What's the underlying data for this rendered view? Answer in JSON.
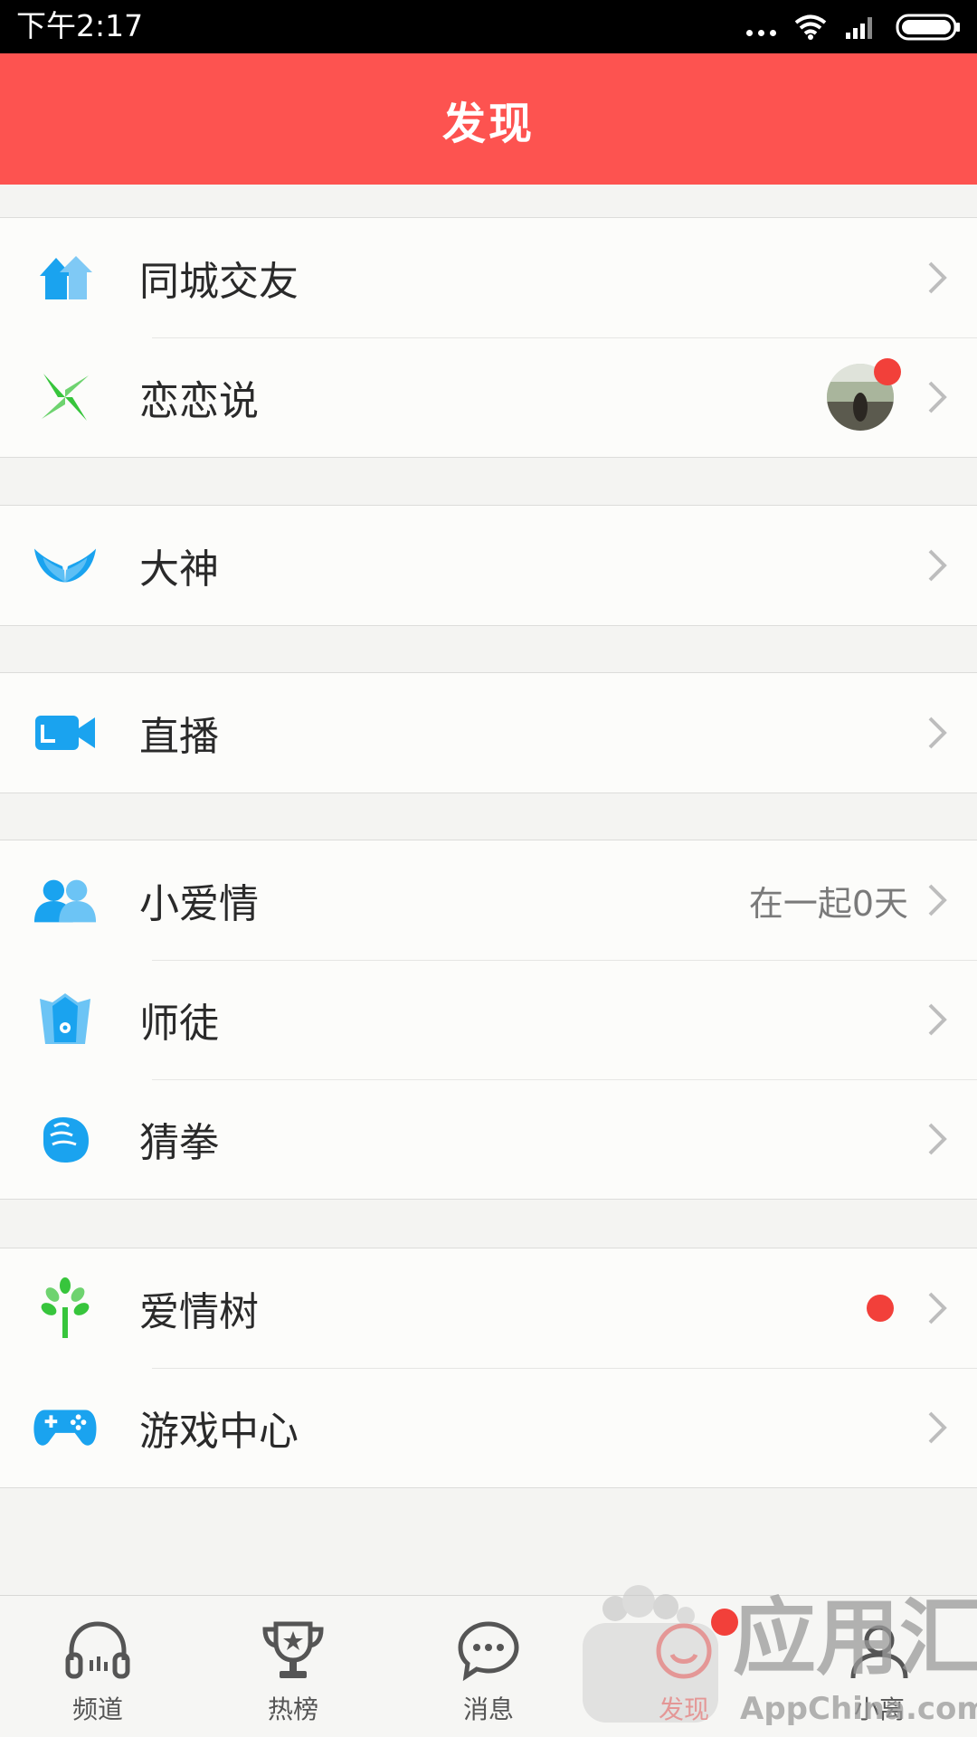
{
  "status_bar": {
    "time": "下午2:17"
  },
  "header": {
    "title": "发现"
  },
  "groups": [
    {
      "items": [
        {
          "label": "同城交友",
          "icon": "house-arrows-icon"
        },
        {
          "label": "恋恋说",
          "icon": "pinwheel-icon",
          "has_avatar_badge": true
        }
      ]
    },
    {
      "items": [
        {
          "label": "大神",
          "icon": "wings-icon"
        }
      ]
    },
    {
      "items": [
        {
          "label": "直播",
          "icon": "video-camera-icon"
        }
      ]
    },
    {
      "items": [
        {
          "label": "小爱情",
          "icon": "couple-icon",
          "extra": "在一起0天"
        },
        {
          "label": "师徒",
          "icon": "pen-nib-icon"
        },
        {
          "label": "猜拳",
          "icon": "fist-icon"
        }
      ]
    },
    {
      "items": [
        {
          "label": "爱情树",
          "icon": "tree-icon",
          "has_red_dot": true
        },
        {
          "label": "游戏中心",
          "icon": "gamepad-icon"
        }
      ]
    }
  ],
  "tabbar": [
    {
      "label": "频道",
      "icon": "headphones-icon"
    },
    {
      "label": "热榜",
      "icon": "trophy-icon"
    },
    {
      "label": "消息",
      "icon": "chat-bubble-icon"
    },
    {
      "label": "发现",
      "icon": "discover-icon",
      "active": true,
      "badge": true
    },
    {
      "label": "小离",
      "icon": "profile-icon"
    }
  ],
  "watermark": {
    "text_cn": "应用汇",
    "text_en": "AppChina.com"
  },
  "colors": {
    "accent": "#fd5350",
    "icon_blue": "#1aa3ef",
    "icon_green": "#37c53c",
    "badge_red": "#f2403a"
  }
}
